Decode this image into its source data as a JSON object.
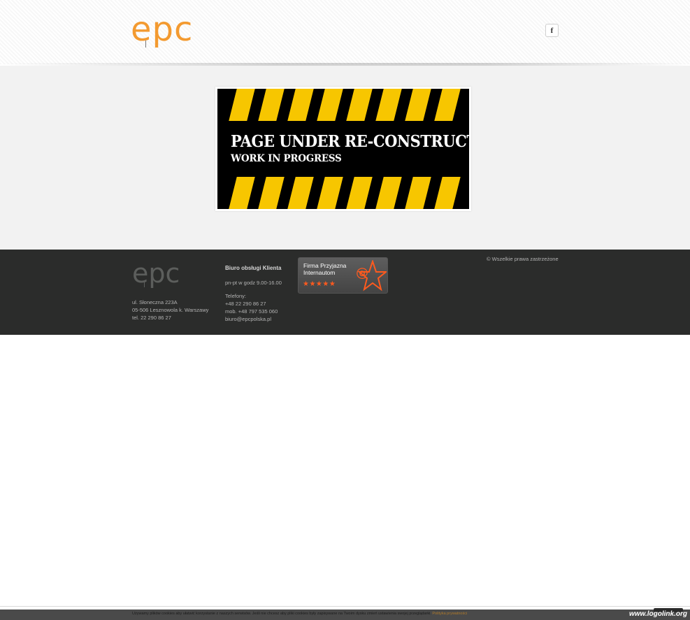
{
  "header": {
    "logo_text": "epc",
    "logo_color": "#f39a30",
    "social": {
      "facebook_label": "f",
      "icon": "facebook-icon"
    }
  },
  "banner": {
    "title": "PAGE UNDER RE-CONSTRUCTION",
    "subtitle": "WORK IN PROGRESS",
    "stripe_color": "#f7c600"
  },
  "footer": {
    "logo_text": "epc",
    "address": {
      "line1": "ul. Słoneczna 223A",
      "line2": "05-506 Lesznowola k. Warszawy",
      "line3": "tel. 22 290 86 27"
    },
    "office": {
      "title": "Biuro obsługi Klienta",
      "hours": "pn-pt w godz 9.00-16.00",
      "phones_label": "Telefony:",
      "phone1": "+48 22 290 86 27",
      "phone2": "mob. +48 797 535 060",
      "email": "biuro@epcpolska.pl"
    },
    "badge": {
      "line1": "Firma Przyjazna",
      "line2": "Internautom",
      "stars": "★★★★★"
    },
    "copyright": "© Wszelkie prawa zastrzeżone"
  },
  "cookie": {
    "text": "Używamy plików cookies aby ułatwić korzystanie z naszych serwisów. Jeśli nie chcesz aby pliki cookies były zapisywane na Twoim dysku zmień ustawienia swojej przeglądarki.",
    "link": "Polityka prywatności"
  },
  "watermark": "www.logolink.org"
}
